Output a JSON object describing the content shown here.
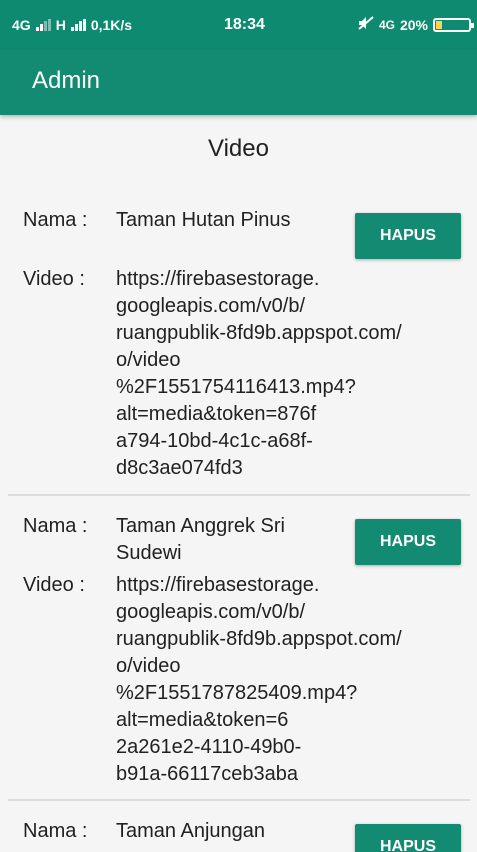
{
  "status_bar": {
    "network_left": "4G",
    "network_mid": "H",
    "speed": "0,1K/s",
    "time": "18:34",
    "network_right": "4G",
    "battery": "20%",
    "battery_level": 0.2
  },
  "app_bar": {
    "title": "Admin"
  },
  "page": {
    "title": "Video"
  },
  "labels": {
    "nama": "Nama :",
    "video": "Video :",
    "delete_button": "HAPUS"
  },
  "items": [
    {
      "nama": "Taman Hutan Pinus",
      "video_lines": [
        "https://firebasestorage.",
        "googleapis.com/v0/b/",
        "ruangpublik-8fd9b.appspot.com/",
        "o/video",
        "%2F1551754116413.mp4?",
        "alt=media&token=876f",
        "a794-10bd-4c1c-a68f-",
        "d8c3ae074fd3"
      ]
    },
    {
      "nama": "Taman Anggrek Sri Sudewi",
      "video_lines": [
        "https://firebasestorage.",
        "googleapis.com/v0/b/",
        "ruangpublik-8fd9b.appspot.com/",
        "o/video",
        "%2F1551787825409.mp4?",
        "alt=media&token=6",
        "2a261e2-4110-49b0-",
        "b91a-66117ceb3aba"
      ]
    },
    {
      "nama": "Taman Anjungan",
      "video_lines": []
    }
  ]
}
